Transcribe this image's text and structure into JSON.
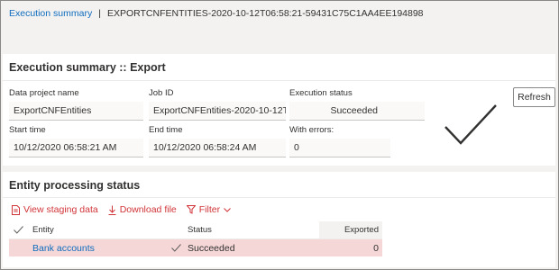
{
  "breadcrumb": {
    "link": "Execution summary",
    "separator": "|",
    "current": "EXPORTCNFENTITIES-2020-10-12T06:58:21-59431C75C1AA4EE194898"
  },
  "summary": {
    "title": "Execution summary :: Export",
    "fields": {
      "data_project_name": {
        "label": "Data project name",
        "value": "ExportCNFEntities"
      },
      "job_id": {
        "label": "Job ID",
        "value": "ExportCNFEntities-2020-10-12T..."
      },
      "execution_status": {
        "label": "Execution status",
        "value": "Succeeded"
      },
      "start_time": {
        "label": "Start time",
        "value": "10/12/2020 06:58:21 AM"
      },
      "end_time": {
        "label": "End time",
        "value": "10/12/2020 06:58:24 AM"
      },
      "with_errors": {
        "label": "With errors:",
        "value": "0"
      }
    },
    "refresh_label": "Refresh",
    "status_icon": "checkmark-icon"
  },
  "entity_status": {
    "title": "Entity processing status",
    "toolbar": {
      "view_staging": "View staging data",
      "download": "Download file",
      "filter": "Filter"
    },
    "columns": {
      "entity": "Entity",
      "status": "Status",
      "exported": "Exported"
    },
    "rows": [
      {
        "entity": "Bank accounts",
        "status": "Succeeded",
        "exported": "0"
      }
    ]
  },
  "colors": {
    "accent": "#0f6cbd",
    "action": "#d13438",
    "selected_row": "#f5d7d8",
    "background": "#f3f2f1"
  }
}
